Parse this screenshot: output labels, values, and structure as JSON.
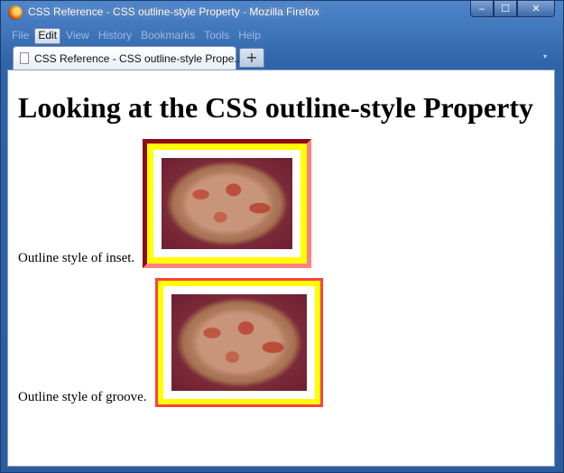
{
  "window": {
    "title": "CSS Reference - CSS outline-style Property - Mozilla Firefox",
    "controls": {
      "minimize": "‒",
      "maximize": "☐",
      "close": "✕"
    }
  },
  "menubar": {
    "items": [
      {
        "label": "File"
      },
      {
        "label": "Edit"
      },
      {
        "label": "View"
      },
      {
        "label": "History"
      },
      {
        "label": "Bookmarks"
      },
      {
        "label": "Tools"
      },
      {
        "label": "Help"
      }
    ]
  },
  "tabs": {
    "active": {
      "label": "CSS Reference - CSS outline-style Prope...",
      "close": "×"
    },
    "new_tab": "+",
    "list_arrow": "▾"
  },
  "page": {
    "heading": "Looking at the CSS outline-style Property",
    "examples": [
      {
        "caption": "Outline style of inset.",
        "style": "inset",
        "outline_color": "#ffff00",
        "border_color": "#ff4040",
        "image_alt": "photo of a baked casserole dish"
      },
      {
        "caption": "Outline style of groove.",
        "style": "groove",
        "outline_color": "#ffff00",
        "border_color": "#ff4040",
        "image_alt": "photo of a baked casserole dish"
      }
    ]
  },
  "colors": {
    "titlebar": "#4f86c9",
    "page_bg": "#ffffff",
    "outline_yellow": "#ffff00",
    "border_red": "#ff4040"
  }
}
